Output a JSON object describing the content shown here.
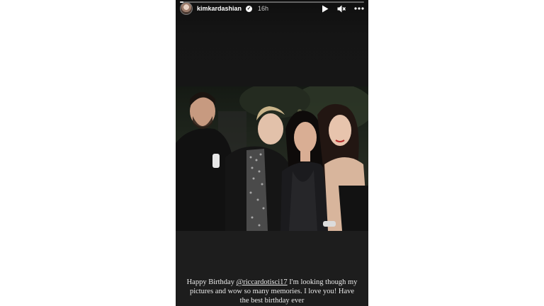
{
  "story": {
    "username": "kimkardashian",
    "time": "16h",
    "progress": 0.02,
    "verified_icon": "check-badge-icon",
    "controls": [
      "play-icon",
      "mute-icon",
      "more-icon"
    ],
    "photo_description_icon": "photo",
    "caption": {
      "before": "Happy Birthday ",
      "mention": "@riccardotisci17",
      "after": " I'm looking though my pictures and wow so many memories. I love you! Have the best birthday ever"
    }
  }
}
